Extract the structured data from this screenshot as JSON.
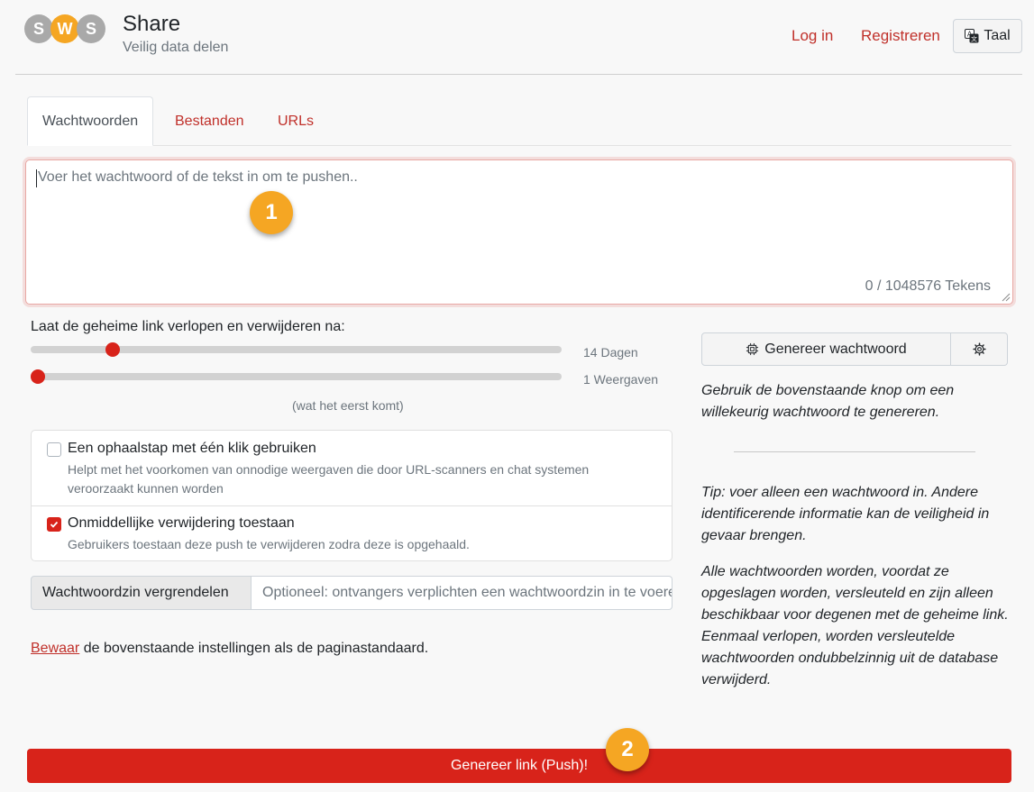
{
  "header": {
    "logo_text": "SWS",
    "title": "Share",
    "subtitle": "Veilig data delen",
    "login": "Log in",
    "register": "Registreren",
    "language": "Taal"
  },
  "tabs": [
    {
      "label": "Wachtwoorden",
      "active": true
    },
    {
      "label": "Bestanden",
      "active": false
    },
    {
      "label": "URLs",
      "active": false
    }
  ],
  "payload": {
    "placeholder": "Voer het wachtwoord of de tekst in om te pushen..",
    "char_count": "0 / 1048576 Tekens"
  },
  "badges": {
    "step1": "1",
    "step2": "2"
  },
  "expiry": {
    "label": "Laat de geheime link verlopen en verwijderen na:",
    "days_label": "14 Dagen",
    "days_value": 14,
    "days_fraction": 0.155,
    "views_label": "1 Weergaven",
    "views_value": 1,
    "views_fraction": 0.0,
    "whichever": "(wat het eerst komt)"
  },
  "options": [
    {
      "title": "Een ophaalstap met één klik gebruiken",
      "help": "Helpt met het voorkomen van onnodige weergaven die door URL-scanners en chat systemen veroorzaakt kunnen worden",
      "checked": false
    },
    {
      "title": "Onmiddellijke verwijdering toestaan",
      "help": "Gebruikers toestaan deze push te verwijderen zodra deze is opgehaald.",
      "checked": true
    }
  ],
  "passphrase": {
    "label": "Wachtwoordzin vergrendelen",
    "placeholder": "Optioneel: ontvangers verplichten een wachtwoordzin in te voeren"
  },
  "save": {
    "link": "Bewaar",
    "text": " de bovenstaande instellingen als de paginastandaard."
  },
  "generator": {
    "button": "Genereer wachtwoord",
    "hint": "Gebruik de bovenstaande knop om een willekeurig wachtwoord te genereren."
  },
  "tips": {
    "tip1": "Tip: voer alleen een wachtwoord in. Andere identificerende informatie kan de veiligheid in gevaar brengen.",
    "tip2": "Alle wachtwoorden worden, voordat ze opgeslagen worden, versleuteld en zijn alleen beschikbaar voor degenen met de geheime link. Eenmaal verlopen, worden versleutelde wachtwoorden ondubbelzinnig uit de database verwijderd."
  },
  "submit": "Genereer link (Push)!",
  "colors": {
    "accent": "#d8231a",
    "link": "#c0302a",
    "badge": "#f5a623",
    "logo_gray": "#a9a9a9",
    "logo_orange": "#f5a623"
  }
}
